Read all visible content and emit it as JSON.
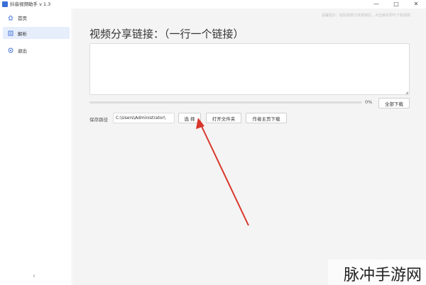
{
  "window": {
    "title": "抖音视频助手 v 1.3",
    "minimize": "—",
    "maximize": "□",
    "close": "✕"
  },
  "sidebar": {
    "items": [
      {
        "label": "首页",
        "icon": "home-icon"
      },
      {
        "label": "解析",
        "icon": "parse-icon",
        "active": true
      },
      {
        "label": "退出",
        "icon": "exit-icon"
      }
    ],
    "collapse": "‹"
  },
  "main": {
    "hint": "温馨提示：粘贴视频分享链接后，点击解析即可下载视频",
    "heading": "视频分享链接：（一行一个链接）",
    "link_input": {
      "value": "",
      "placeholder": ""
    },
    "progress": {
      "percent": 0,
      "label": "0%"
    },
    "download_all": "全部下载",
    "save_path_label": "保存路径",
    "save_path_value": "C:\\Users\\Administrator\\",
    "select_button": "选 择",
    "open_folder_button": "打开文件夹",
    "author_download_button": "作者主页下载"
  },
  "watermark": {
    "text": "脉冲手游网"
  },
  "colors": {
    "accent": "#409eff",
    "arrow": "#d9362b",
    "active_bg": "#e6eefc"
  }
}
